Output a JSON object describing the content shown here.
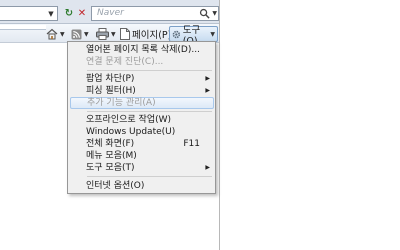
{
  "toolbar": {
    "search_placeholder": "Naver",
    "page_label": "페이지(P)",
    "tools_label": "도구(O)"
  },
  "tools_menu": {
    "items": [
      {
        "label": "열어본 페이지 목록 삭제(D)...",
        "enabled": true
      },
      {
        "label": "연결 문제 진단(C)...",
        "enabled": false
      },
      {
        "label": "팝업 차단(P)",
        "enabled": true,
        "submenu": true
      },
      {
        "label": "피싱 필터(H)",
        "enabled": true,
        "submenu": true
      },
      {
        "label": "추가 기능 관리(A)",
        "enabled": false,
        "highlighted": true
      },
      {
        "label": "오프라인으로 작업(W)",
        "enabled": true
      },
      {
        "label": "Windows Update(U)",
        "enabled": true
      },
      {
        "label": "전체 화면(F)",
        "enabled": true,
        "shortcut": "F11"
      },
      {
        "label": "메뉴 모음(M)",
        "enabled": true
      },
      {
        "label": "도구 모음(T)",
        "enabled": true,
        "submenu": true
      },
      {
        "label": "인터넷 옵션(O)",
        "enabled": true
      }
    ]
  },
  "icons": [
    "refresh-icon",
    "stop-icon",
    "search-icon",
    "home-icon",
    "feeds-icon",
    "print-icon",
    "page-icon",
    "gear-icon"
  ],
  "colors": {
    "menu_bg": "#f0f0f0",
    "highlight": "#dde9f7",
    "disabled_text": "#9c9c9c"
  }
}
